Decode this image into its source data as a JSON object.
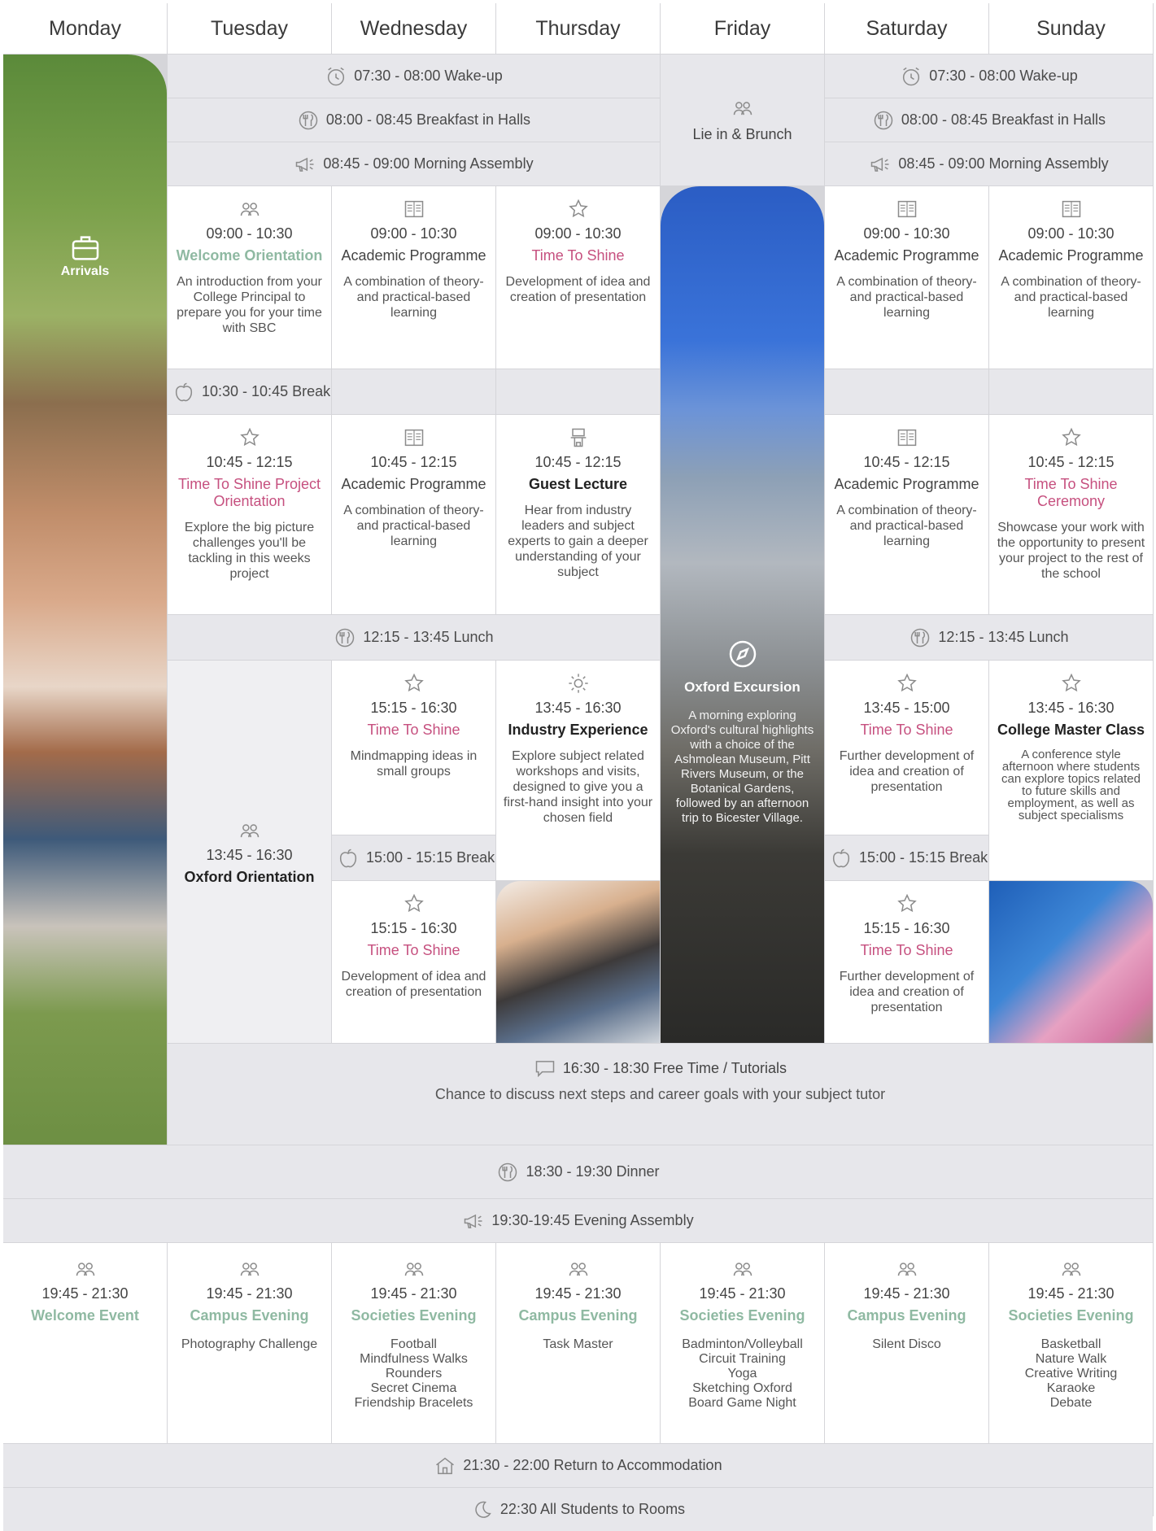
{
  "days": [
    "Monday",
    "Tuesday",
    "Wednesday",
    "Thursday",
    "Friday",
    "Saturday",
    "Sunday"
  ],
  "morning_bands": {
    "wakeup": "07:30 - 08:00  Wake-up",
    "breakfast": "08:00 - 08:45  Breakfast in Halls",
    "assembly": "08:45 - 09:00  Morning Assembly"
  },
  "friday_morning": "Lie in & Brunch",
  "arrivals": "Arrivals",
  "session1": {
    "tuesday": {
      "time": "09:00 - 10:30",
      "title": "Welcome Orientation",
      "desc": "An introduction from your College Principal to prepare you for your time with SBC"
    },
    "wednesday": {
      "time": "09:00 - 10:30",
      "title": "Academic Programme",
      "desc": "A combination of theory- and practical-based learning"
    },
    "thursday": {
      "time": "09:00 - 10:30",
      "title": "Time To Shine",
      "desc": "Development of idea and creation of presentation"
    },
    "saturday": {
      "time": "09:00 - 10:30",
      "title": "Academic Programme",
      "desc": "A combination of theory- and practical-based learning"
    },
    "sunday": {
      "time": "09:00 - 10:30",
      "title": "Academic Programme",
      "desc": "A combination of theory- and practical-based learning"
    }
  },
  "break_morning": "10:30 - 10:45  Break",
  "session2": {
    "tuesday": {
      "time": "10:45 - 12:15",
      "title": "Time To Shine Project Orientation",
      "desc": "Explore the big picture challenges you'll be tackling in this weeks project"
    },
    "wednesday": {
      "time": "10:45 - 12:15",
      "title": "Academic Programme",
      "desc": "A combination of theory- and practical-based learning"
    },
    "thursday": {
      "time": "10:45 - 12:15",
      "title": "Guest Lecture",
      "desc": "Hear from industry leaders and subject experts to gain a deeper understanding of your subject"
    },
    "saturday": {
      "time": "10:45 - 12:15",
      "title": "Academic Programme",
      "desc": "A combination of theory- and practical-based learning"
    },
    "sunday": {
      "time": "10:45 - 12:15",
      "title": "Time To Shine Ceremony",
      "desc": "Showcase your work with the opportunity to present your  project to the rest of the school"
    }
  },
  "lunch": "12:15 - 13:45  Lunch",
  "afternoon": {
    "tuesday": {
      "time": "13:45 - 16:30",
      "title": "Oxford Orientation"
    },
    "wednesday_a": {
      "time": "15:15 - 16:30",
      "title": "Time To Shine",
      "desc": "Mindmapping ideas in small groups"
    },
    "wednesday_b": {
      "time": "15:15 - 16:30",
      "title": "Time To Shine",
      "desc": "Development of idea and creation of presentation"
    },
    "thursday": {
      "time": "13:45 - 16:30",
      "title": "Industry Experience",
      "desc": "Explore subject related workshops and visits, designed to give you a first-hand insight into your chosen field"
    },
    "friday": {
      "title": "Oxford Excursion",
      "desc": "A morning exploring Oxford's cultural highlights with a choice of the Ashmolean Museum, Pitt Rivers Museum, or the Botanical Gardens, followed by an afternoon trip to Bicester Village."
    },
    "saturday_a": {
      "time": "13:45 - 15:00",
      "title": "Time To Shine",
      "desc": "Further development of idea and creation of presentation"
    },
    "saturday_b": {
      "time": "15:15 - 16:30",
      "title": "Time To Shine",
      "desc": "Further development of idea and creation of presentation"
    },
    "sunday": {
      "time": "13:45 - 16:30",
      "title": "College Master Class",
      "desc": "A conference style afternoon where students can explore topics related to future skills and employment, as well as subject specialisms"
    }
  },
  "break_afternoon": "15:00 - 15:15  Break",
  "free_time": {
    "line1": "16:30 - 18:30 Free Time / Tutorials",
    "line2": "Chance to discuss next steps and career goals with your subject tutor"
  },
  "dinner": "18:30 - 19:30 Dinner",
  "evening_assembly": "19:30-19:45 Evening Assembly",
  "evening": [
    {
      "time": "19:45 - 21:30",
      "title": "Welcome Event",
      "items": []
    },
    {
      "time": "19:45 - 21:30",
      "title": "Campus Evening",
      "items": [
        "Photography Challenge"
      ]
    },
    {
      "time": "19:45 - 21:30",
      "title": "Societies Evening",
      "items": [
        "Football",
        "Mindfulness Walks",
        "Rounders",
        "Secret Cinema",
        "Friendship Bracelets"
      ]
    },
    {
      "time": "19:45 - 21:30",
      "title": "Campus Evening",
      "items": [
        "Task Master"
      ]
    },
    {
      "time": "19:45 - 21:30",
      "title": "Societies Evening",
      "items": [
        "Badminton/Volleyball",
        "Circuit Training",
        "Yoga",
        "Sketching Oxford",
        "Board Game Night"
      ]
    },
    {
      "time": "19:45 - 21:30",
      "title": "Campus Evening",
      "items": [
        "Silent Disco"
      ]
    },
    {
      "time": "19:45 - 21:30",
      "title": "Societies Evening",
      "items": [
        "Basketball",
        "Nature Walk",
        "Creative Writing",
        "Karaoke",
        "Debate"
      ]
    }
  ],
  "return": "21:30 - 22:00   Return to Accommodation",
  "rooms": "22:30  All Students to Rooms",
  "colors": {
    "green": "#8fb9a2",
    "pink": "#c6507f",
    "band": "#e7e7eb"
  },
  "icons": [
    "clock-icon",
    "cutlery-icon",
    "megaphone-icon",
    "people-icon",
    "book-icon",
    "star-icon",
    "apple-icon",
    "podium-icon",
    "gear-icon",
    "compass-icon",
    "chat-icon",
    "house-icon",
    "moon-icon",
    "luggage-icon"
  ]
}
